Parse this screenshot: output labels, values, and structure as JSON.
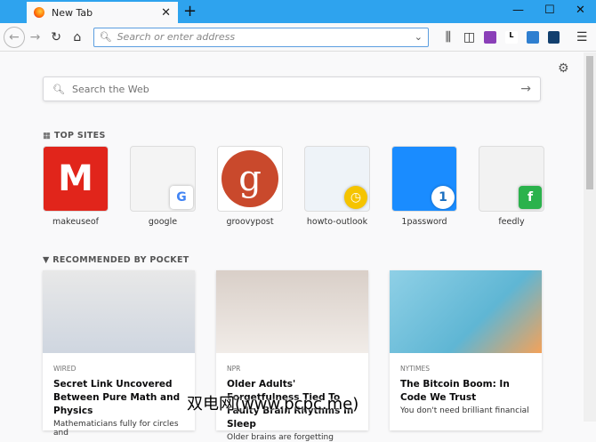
{
  "tab": {
    "title": "New Tab"
  },
  "toolbar": {
    "address_placeholder": "Search or enter address"
  },
  "search": {
    "placeholder": "Search the Web"
  },
  "top_sites": {
    "heading": "TOP SITES",
    "items": [
      {
        "label": "makeuseof"
      },
      {
        "label": "google"
      },
      {
        "label": "groovypost"
      },
      {
        "label": "howto-outlook"
      },
      {
        "label": "1password"
      },
      {
        "label": "feedly"
      }
    ]
  },
  "pocket": {
    "heading": "RECOMMENDED BY POCKET",
    "cards": [
      {
        "source": "WIRED",
        "title": "Secret Link Uncovered Between Pure Math and Physics",
        "desc": "Mathematicians fully for circles and"
      },
      {
        "source": "NPR",
        "title": "Older Adults' Forgetfulness Tied To Faulty Brain Rhythms In Sleep",
        "desc": "Older brains are forgetting"
      },
      {
        "source": "NYTIMES",
        "title": "The Bitcoin Boom: In Code We Trust",
        "desc": "You don't need brilliant financial"
      }
    ]
  },
  "watermark": "双电网(www.pcpc.me)"
}
